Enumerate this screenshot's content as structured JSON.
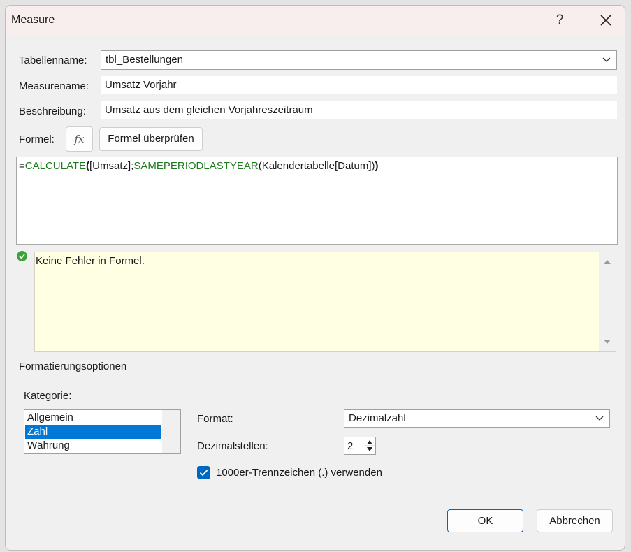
{
  "window": {
    "title": "Measure",
    "help_label": "?"
  },
  "fields": {
    "table_label": "Tabellenname:",
    "table_value": "tbl_Bestellungen",
    "measure_label": "Measurename:",
    "measure_value": "Umsatz Vorjahr",
    "description_label": "Beschreibung:",
    "description_value": "Umsatz aus dem gleichen Vorjahreszeitraum"
  },
  "formula": {
    "label": "Formel:",
    "fx_label": "fx",
    "check_button": "Formel überprüfen",
    "eq": "=",
    "fn1": "CALCULATE",
    "open1": "(",
    "arg1": "[Umsatz];",
    "fn2": "SAMEPERIODLASTYEAR",
    "arg2": "(Kalendertabelle[Datum])",
    "close1": ")"
  },
  "status": {
    "message": "Keine Fehler in Formel."
  },
  "formatting": {
    "section_label": "Formatierungsoptionen",
    "category_label": "Kategorie:",
    "categories": [
      "Allgemein",
      "Zahl",
      "Währung"
    ],
    "selected_category": "Zahl",
    "format_label": "Format:",
    "format_value": "Dezimalzahl",
    "decimals_label": "Dezimalstellen:",
    "decimals_value": "2",
    "thousands_label": "1000er-Trennzeichen (.) verwenden",
    "thousands_checked": true
  },
  "buttons": {
    "ok": "OK",
    "cancel": "Abbrechen"
  },
  "colors": {
    "accent": "#0078d7",
    "function": "#1f7a1f",
    "message_bg": "#ffffe3",
    "success": "#3aa33a"
  }
}
